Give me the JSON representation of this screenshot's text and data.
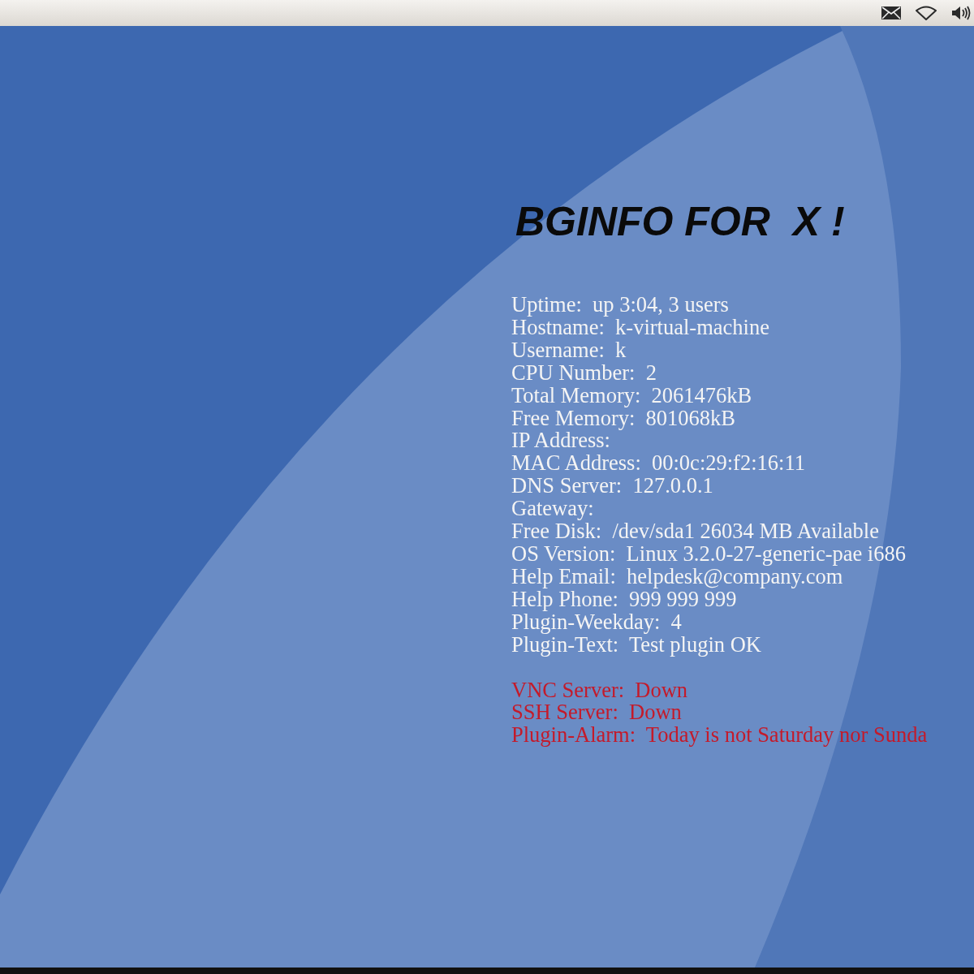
{
  "top_panel": {
    "indicators": [
      {
        "kind": "mail"
      },
      {
        "kind": "network"
      },
      {
        "kind": "volume"
      }
    ]
  },
  "desktop": {
    "title": "BGINFO FOR  X !",
    "info_lines": [
      "Uptime:  up 3:04, 3 users",
      "Hostname:  k-virtual-machine",
      "Username:  k",
      "CPU Number:  2",
      "Total Memory:  2061476kB",
      "Free Memory:  801068kB",
      "IP Address:",
      "MAC Address:  00:0c:29:f2:16:11",
      "DNS Server:  127.0.0.1",
      "Gateway:",
      "Free Disk:  /dev/sda1 26034 MB Available",
      "OS Version:  Linux 3.2.0-27-generic-pae i686",
      "Help Email:  helpdesk@company.com",
      "Help Phone:  999 999 999",
      "Plugin-Weekday:  4",
      "Plugin-Text:  Test plugin OK"
    ],
    "alert_lines": [
      "VNC Server:  Down",
      "SSH Server:  Down",
      "Plugin-Alarm:  Today is not Saturday nor Sunda"
    ]
  }
}
